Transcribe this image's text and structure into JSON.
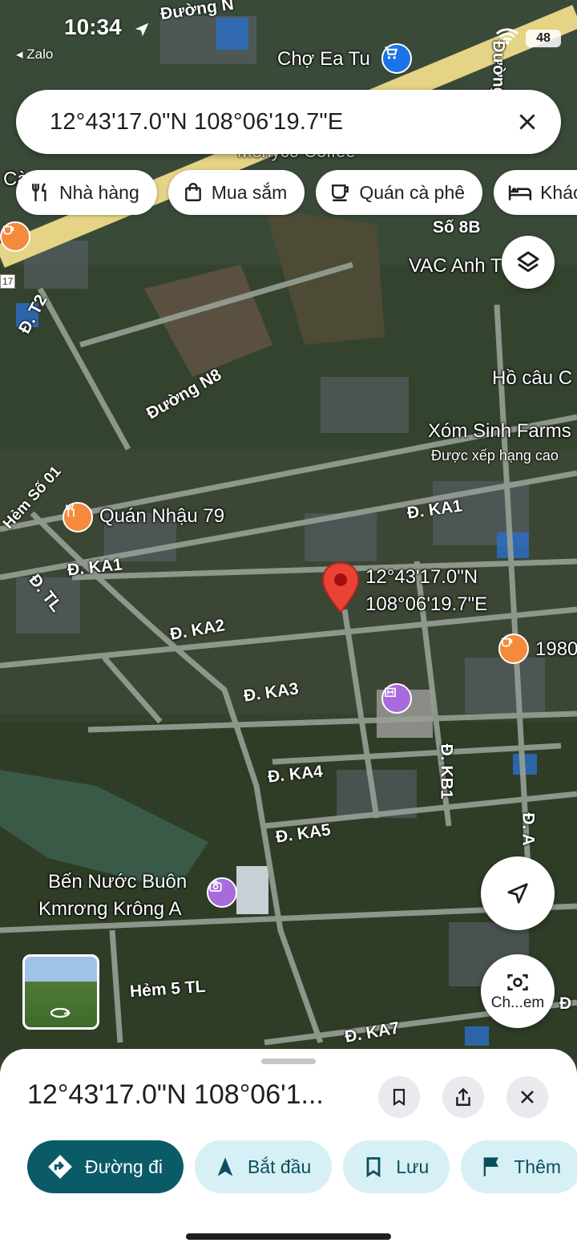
{
  "status_bar": {
    "time": "10:34",
    "back_app": "Zalo",
    "battery": "48"
  },
  "search": {
    "query": "12°43'17.0\"N 108°06'19.7\"E"
  },
  "chips": [
    {
      "label": "Nhà hàng",
      "icon": "fork-knife-icon"
    },
    {
      "label": "Mua sắm",
      "icon": "shopping-bag-icon"
    },
    {
      "label": "Quán cà phê",
      "icon": "coffee-cup-icon"
    },
    {
      "label": "Khác",
      "icon": "bed-icon"
    }
  ],
  "map": {
    "roads": {
      "duong_top": "Đường N",
      "duong_right": "Đường",
      "t2": "Đ. T2",
      "n8": "Đường N8",
      "hem_so_01": "Hẻm Số 01",
      "tl": "Đ. TL",
      "ka1_left": "Đ. KA1",
      "ka1_right": "Đ. KA1",
      "ka2": "Đ. KA2",
      "ka3": "Đ. KA3",
      "ka4": "Đ. KA4",
      "ka5": "Đ. KA5",
      "kb1": "Đ. KB1",
      "a_right": "Đ. A",
      "hem_5_tl": "Hẻm 5 TL",
      "ka7": "Đ. KA7",
      "so_8b": "Số 8B",
      "d_partial": "Đ",
      "route_17": "17"
    },
    "places": {
      "cho_ea_tu": "Chợ Ea Tu",
      "menyco": "Menyco Coffee",
      "vac_anh": "VAC Anh T",
      "ho_cau": "Hồ câu C",
      "xom_sinh": "Xóm Sinh Farms",
      "xom_sinh_sub": "Được xếp hạng cao",
      "quan_nhau": "Quán Nhậu 79",
      "cafe_1980": "1980",
      "ben_nuoc_1": "Bến Nước Buôn",
      "ben_nuoc_2": "Kmrơng Krông A",
      "left_partial": "Cà"
    },
    "pin": {
      "lat": "12°43'17.0\"N",
      "lng": "108°06'19.7\"E"
    },
    "streetview_label": "Ch...em"
  },
  "sheet": {
    "title": "12°43'17.0\"N 108°06'1...",
    "actions": [
      {
        "label": "Đường đi",
        "icon": "directions-icon"
      },
      {
        "label": "Bắt đầu",
        "icon": "navigation-arrow-icon"
      },
      {
        "label": "Lưu",
        "icon": "bookmark-icon"
      },
      {
        "label": "Thêm",
        "icon": "flag-icon"
      }
    ]
  },
  "colors": {
    "primary_button": "#0b5a68",
    "secondary_button": "#d6f0f6",
    "pin": "#ea4335",
    "food_poi": "#f58a3c",
    "attraction_poi": "#a86bdc"
  }
}
